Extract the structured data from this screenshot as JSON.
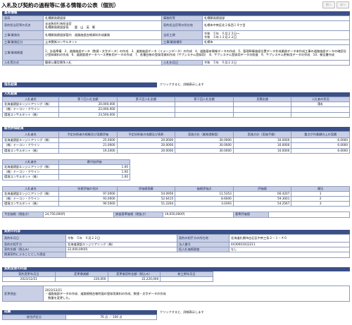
{
  "page": {
    "title": "入札及び契約の過程等に係る情報の公表（個別）",
    "nav_prev": "前へ",
    "nav_next": "次へ"
  },
  "kihon": {
    "section": "基本情報",
    "bukyoku_label": "部局",
    "bukyoku": "札幌開発建設部",
    "jimusho_label": "事務所等",
    "jimusho": "札幌開発建設部",
    "keiyakutanto_label": "契約担当官等の氏名",
    "keiyakutanto": "支出負担行為担当官\n札幌開発建設部長　　富　山　英　範",
    "shozaichi_label": "契約担当官等の所在地",
    "shozaichi": "札幌市中央区北２条西１９丁目",
    "gyomumei_label": "工事/業務名",
    "gyomumei": "札幌開発建設部管内　道路施設台帳資料作成業務",
    "koki_label": "当初工期",
    "koki": "令和　５年　６月２３日～\n令和　５年１２月２２日",
    "shubetsu_label": "工事/業務区分",
    "shubetsu": "土木関係コンサルタント",
    "basho_label": "工事/業務場所",
    "basho": "札幌市",
    "gaiyo_label": "工事/業務概要",
    "gaiyo": "1、計画準備　2、道路施設データ（数値・文字データ）の作成　3、道路施設データ（イメージデータ）の作成　4、道路基本情報データの作成　5、管理幹事施設位置データ作成業務データ本作成工事の道路施設データの確認及び登録資料の作成　6、道路管理データベース更新用データの作成　7、各種台帳の登録用資料作成（サブシステム登録用）　8、サブシステム登録用データの照査　9、サブシステム更新用データの作成　10、報告書作成",
    "nyusatsuhoshiki_label": "入札等方式",
    "nyusatsuhoshiki": "簡易公募型競争入札",
    "nyusatsubi_label": "入札年月日",
    "nyusatsubi": "令和　５年　６月２２日"
  },
  "shimei": {
    "section": "指名結果",
    "note": "クリックすると、詳細表示します"
  },
  "nyusatsu": {
    "section": "入札結果",
    "headers": [
      "入札者名",
      "第１回入札金額",
      "第２回入札金額",
      "第３回入札金額",
      "見積金額",
      "入札者の状況"
    ],
    "rows": [
      [
        "北海道建設エンジニアリング（株）",
        "20,000,000",
        "",
        "",
        "",
        "落札"
      ],
      [
        "（株）ドーコン・クウイン",
        "22,000,000",
        "",
        "",
        "",
        ""
      ],
      [
        "環境コンサルタント（株）",
        "23,500,000",
        "",
        "",
        "",
        ""
      ]
    ]
  },
  "hyoka1": {
    "section": "総合評価結果",
    "headers": [
      "入札者名",
      "予定技術者の経験及び実績評価",
      "予定技術者の成績及び表彰",
      "実施方針（業務理解度）",
      "実施方針（実施手順）",
      "重点が作業額向上の実績"
    ],
    "rows": [
      [
        "北海道建設エンジニアリング（株）",
        "25.0000",
        "20.0000",
        "30.0000",
        "16.0000",
        "6.0000"
      ],
      [
        "（株）ドーコン・クウイン",
        "21.0000",
        "20.0000",
        "30.0000",
        "16.0000",
        "6.0000"
      ],
      [
        "環境コンサルタント（株）",
        "19.2000",
        "20.0000",
        "30.0000",
        "16.0000",
        "6.0000"
      ]
    ]
  },
  "hyoka2": {
    "headers": [
      "入札者名",
      "賃付加評価"
    ],
    "rows": [
      [
        "北海道建設エンジニアリング（株）",
        "1.00"
      ],
      [
        "（株）ドーコン・クウイン",
        "1.00"
      ],
      [
        "環境コンサルタント（株）",
        "1.00"
      ]
    ]
  },
  "hyoka3": {
    "headers": [
      "入札者名",
      "技術評価の合計",
      "評価値換算",
      "価格評価点",
      "評価値",
      "順位"
    ],
    "rows": [
      [
        "北海道建設エンジニアリング（株）",
        "97.0000",
        "54.0956",
        "11.5353",
        "66.4207",
        "1"
      ],
      [
        "（株）ドーコン・クウイン",
        "93.0000",
        "52.6415",
        "8.6000",
        "59.3001",
        "2"
      ],
      [
        "環境コンサルタント（株）",
        "90.5000",
        "51.2264",
        "3.0393",
        "54.2567",
        "3"
      ]
    ]
  },
  "yotei": {
    "yotei_label": "予定価格（税抜き）",
    "yotei": "24,750,000円",
    "chosa_label": "調査基準価格（税抜き）",
    "chosa": "19,650,000円",
    "kijun_label": "基準評価値",
    "kijun": ""
  },
  "keiyaku": {
    "section": "契約の内容",
    "nengappi_label": "契約年月日",
    "nengappi": "令和　５年　６月２２日",
    "aite_shozaichi_label": "契約の相手方の所在地",
    "aite_shozaichi": "北海道札幌市白石区中央三条２－１－４０",
    "aite_label": "契約の相手方",
    "aite": "北海道建設エンジニアリング（株）",
    "hojin_label": "法人番号",
    "hojin": "4430001022211",
    "kingaku_label": "契約金額（税込み）",
    "kingaku": "22,000,000円",
    "teikakaku_label": "低入札価格調査",
    "teikakaku": "なし",
    "yotei_kakaku_label": "随意契約によることとした理由",
    "yotei_kakaku": ""
  },
  "henko": {
    "section": "契約変更の内容",
    "headers": [
      "契約変更年月日",
      "変更増減額",
      "変更後契約金額（税込み）",
      "新工期年月日"
    ],
    "row": [
      "2023/12/21",
      "220,000",
      "22,220,000",
      ""
    ],
    "riyu_label": "変更理由",
    "riyu": "2023/12/21\n・道路施設データの作成、道路規格台帳附図の登録用資料の作成、数値・文字データの作成\n　数量を変更した。"
  },
  "seiseki": {
    "section": "成績",
    "note": "クリックすると、詳細表示します",
    "label": "総合評定点",
    "value": "76 点 ／ 100 点"
  }
}
